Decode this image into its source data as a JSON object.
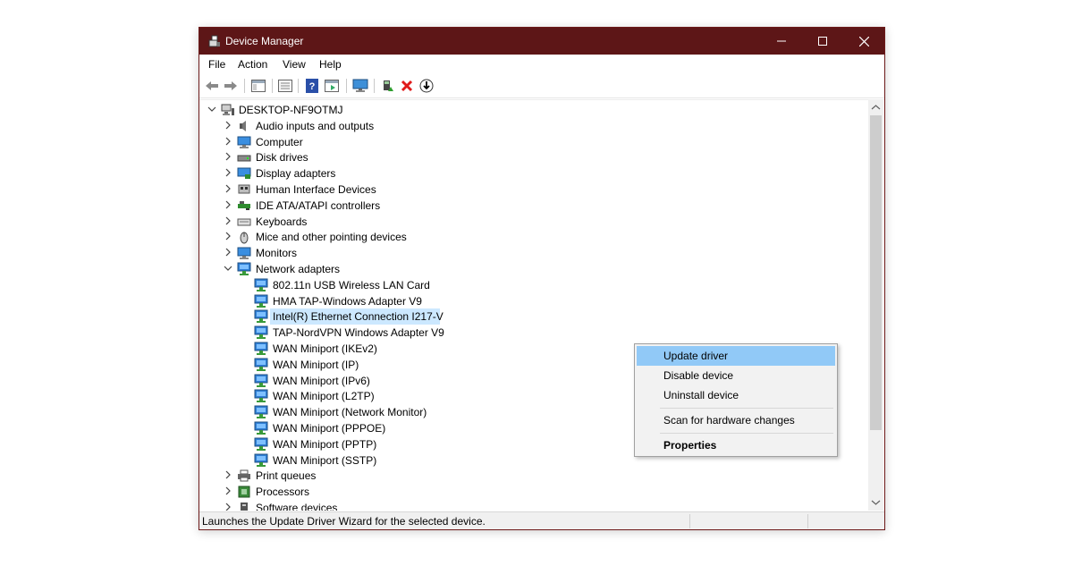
{
  "window": {
    "title": "Device Manager",
    "titlebar_color": "#5d1617"
  },
  "menu": [
    "File",
    "Action",
    "View",
    "Help"
  ],
  "toolbar": {
    "icons": [
      "back-arrow-icon",
      "forward-arrow-icon",
      "show-hide-console-tree-icon",
      "properties-icon",
      "help-icon",
      "action-pane-icon",
      "monitor-icon",
      "update-driver-icon",
      "uninstall-icon",
      "download-icon"
    ]
  },
  "tree": {
    "root": "DESKTOP-NF9OTMJ",
    "categories": [
      {
        "label": "Audio inputs and outputs",
        "icon": "speaker-icon"
      },
      {
        "label": "Computer",
        "icon": "computer-icon"
      },
      {
        "label": "Disk drives",
        "icon": "disk-drive-icon"
      },
      {
        "label": "Display adapters",
        "icon": "display-adapter-icon"
      },
      {
        "label": "Human Interface Devices",
        "icon": "hid-icon"
      },
      {
        "label": "IDE ATA/ATAPI controllers",
        "icon": "ide-controller-icon"
      },
      {
        "label": "Keyboards",
        "icon": "keyboard-icon"
      },
      {
        "label": "Mice and other pointing devices",
        "icon": "mouse-icon"
      },
      {
        "label": "Monitors",
        "icon": "monitor-icon"
      },
      {
        "label": "Network adapters",
        "icon": "network-adapter-icon"
      }
    ],
    "network_adapters": [
      "802.11n USB Wireless LAN Card",
      "HMA TAP-Windows Adapter V9",
      "Intel(R) Ethernet Connection I217-V",
      "TAP-NordVPN Windows Adapter V9",
      "WAN Miniport (IKEv2)",
      "WAN Miniport (IP)",
      "WAN Miniport (IPv6)",
      "WAN Miniport (L2TP)",
      "WAN Miniport (Network Monitor)",
      "WAN Miniport (PPPOE)",
      "WAN Miniport (PPTP)",
      "WAN Miniport (SSTP)"
    ],
    "after": [
      {
        "label": "Print queues",
        "icon": "printer-icon"
      },
      {
        "label": "Processors",
        "icon": "processor-icon"
      },
      {
        "label": "Software devices",
        "icon": "software-device-icon"
      }
    ]
  },
  "context_menu": {
    "items": [
      "Update driver",
      "Disable device",
      "Uninstall device",
      "Scan for hardware changes",
      "Properties"
    ],
    "highlight_color": "#91c9f7"
  },
  "status": {
    "text": "Launches the Update Driver Wizard for the selected device."
  }
}
